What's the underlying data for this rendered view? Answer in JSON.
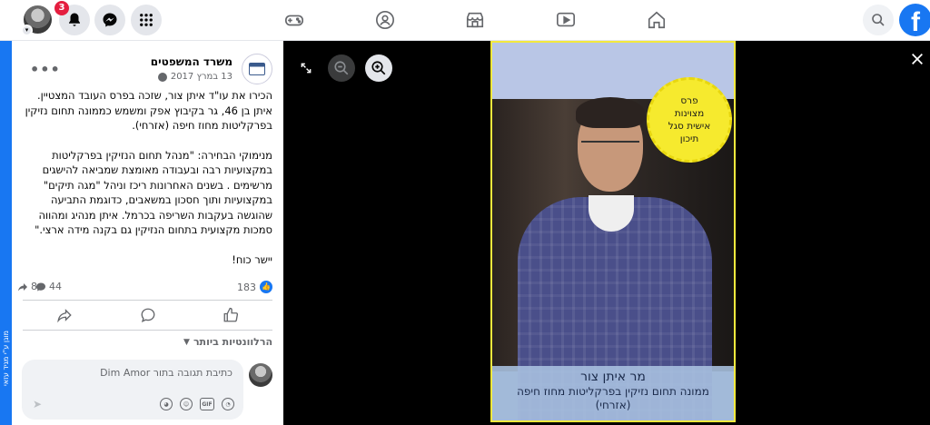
{
  "topbar": {
    "notifications_badge": "3",
    "icons": [
      "bell-icon",
      "messenger-icon",
      "grid-menu-icon",
      "gaming-icon",
      "groups-icon",
      "marketplace-icon",
      "watch-icon",
      "home-icon",
      "search-icon",
      "facebook-logo"
    ],
    "brand_color": "#1877f2"
  },
  "side_strip": {
    "text": "מוגן ע\"י מגיד עזאי"
  },
  "post": {
    "page_name": "משרד המשפטים",
    "date": "13 במרץ 2017",
    "more_label": "•••",
    "paragraph1": "הכירו את עו\"ד איתן צור, שזכה בפרס העובד המצטיין. איתן בן 46, גר בקיבוץ אפק ומשמש כממונה תחום נזיקין בפרקליטות מחוז חיפה (אזרחי).",
    "paragraph2": "מנימוקי הבחירה: \"מנהל תחום הנזיקין בפרקליטות במקצועיות רבה ובעבודה מאומצת שמביאה להישגים מרשימים . בשנים האחרונות ריכז וניהל \"מגה תיקים\" במקצועיות ותוך חסכון במשאבים, כדוגמת התביעה שהוגשה בעקבות השריפה בכרמל. איתן מנהיג ומהווה סמכות מקצועית בתחום הנזיקין גם בקנה מידה ארצי.\"",
    "paragraph3": "יישר כוח!",
    "likes": "183",
    "comments": "44",
    "shares": "8",
    "relevance_label": "הרלוונטיות ביותר",
    "comment_placeholder": "כתיבת תגובה בתור Dim Amor",
    "comment_tools": [
      "sticker-icon",
      "gif-icon",
      "emoji-icon",
      "avatar-sticker-icon"
    ]
  },
  "viewer": {
    "award_lines": [
      "פרס",
      "מצוינות",
      "אישית סגל",
      "תיכון"
    ],
    "caption_name": "מר איתן צור",
    "caption_title1": "ממונה תחום נזיקין בפרקליטות מחוז חיפה",
    "caption_title2": "(אזרחי)",
    "frame_color": "#f3e93d"
  }
}
